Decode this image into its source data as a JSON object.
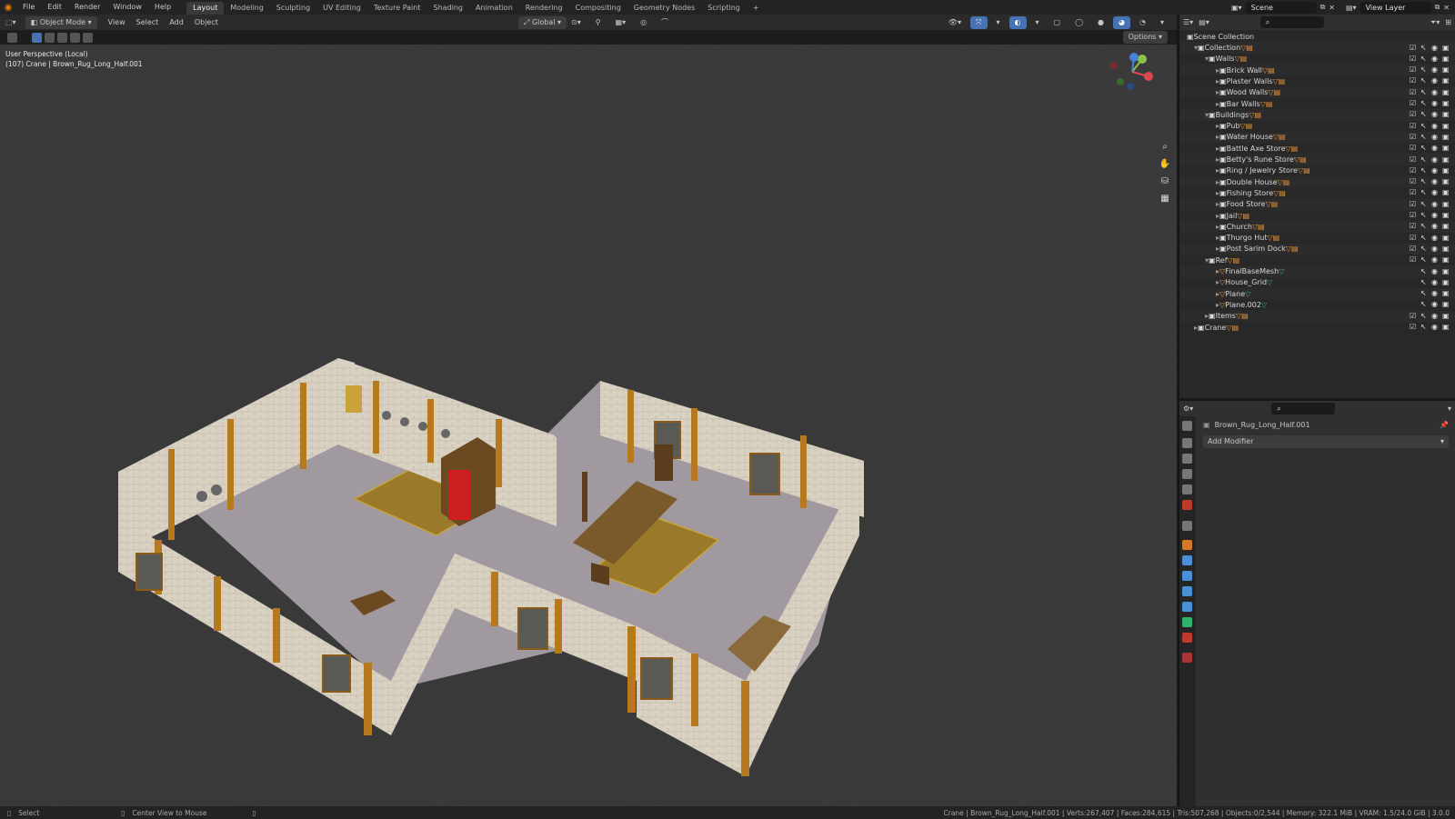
{
  "topbar": {
    "menus": [
      "File",
      "Edit",
      "Render",
      "Window",
      "Help"
    ],
    "workspaces": [
      "Layout",
      "Modeling",
      "Sculpting",
      "UV Editing",
      "Texture Paint",
      "Shading",
      "Animation",
      "Rendering",
      "Compositing",
      "Geometry Nodes",
      "Scripting"
    ],
    "active_workspace": "Layout",
    "scene": "Scene",
    "view_layer": "View Layer"
  },
  "viewport_header": {
    "mode": "Object Mode",
    "menus": [
      "View",
      "Select",
      "Add",
      "Object"
    ],
    "orientation": "Global",
    "options_label": "Options"
  },
  "viewport": {
    "perspective": "User Perspective (Local)",
    "selection": "(107) Crane | Brown_Rug_Long_Half.001"
  },
  "outliner": {
    "root": "Scene Collection",
    "rows": [
      {
        "label": "Collection",
        "depth": 1,
        "kind": "collection",
        "expanded": true
      },
      {
        "label": "Walls",
        "depth": 2,
        "kind": "collection",
        "expanded": true
      },
      {
        "label": "Brick Wall",
        "depth": 3,
        "kind": "object"
      },
      {
        "label": "Plaster Walls",
        "depth": 3,
        "kind": "object"
      },
      {
        "label": "Wood Walls",
        "depth": 3,
        "kind": "object"
      },
      {
        "label": "Bar Walls",
        "depth": 3,
        "kind": "object"
      },
      {
        "label": "Buildings",
        "depth": 2,
        "kind": "collection",
        "expanded": true
      },
      {
        "label": "Pub",
        "depth": 3,
        "kind": "object"
      },
      {
        "label": "Water House",
        "depth": 3,
        "kind": "object"
      },
      {
        "label": "Battle Axe Store",
        "depth": 3,
        "kind": "object"
      },
      {
        "label": "Betty's Rune Store",
        "depth": 3,
        "kind": "object"
      },
      {
        "label": "Ring / Jewelry Store",
        "depth": 3,
        "kind": "object"
      },
      {
        "label": "Double House",
        "depth": 3,
        "kind": "object"
      },
      {
        "label": "Fishing Store",
        "depth": 3,
        "kind": "object"
      },
      {
        "label": "Food Store",
        "depth": 3,
        "kind": "object"
      },
      {
        "label": "Jail",
        "depth": 3,
        "kind": "object"
      },
      {
        "label": "Church",
        "depth": 3,
        "kind": "object"
      },
      {
        "label": "Thurgo Hut",
        "depth": 3,
        "kind": "object"
      },
      {
        "label": "Post Sarim Dock",
        "depth": 3,
        "kind": "object"
      },
      {
        "label": "Ref",
        "depth": 2,
        "kind": "collection",
        "expanded": true
      },
      {
        "label": "FinalBaseMesh",
        "depth": 3,
        "kind": "mesh"
      },
      {
        "label": "House_Grid",
        "depth": 3,
        "kind": "mesh"
      },
      {
        "label": "Plane",
        "depth": 3,
        "kind": "mesh"
      },
      {
        "label": "Plane.002",
        "depth": 3,
        "kind": "mesh"
      },
      {
        "label": "Items",
        "depth": 2,
        "kind": "collection"
      },
      {
        "label": "Crane",
        "depth": 1,
        "kind": "collection"
      }
    ]
  },
  "properties": {
    "object_name": "Brown_Rug_Long_Half.001",
    "add_modifier": "Add Modifier"
  },
  "statusbar": {
    "select": "Select",
    "center": "Center View to Mouse",
    "stats": "Crane | Brown_Rug_Long_Half.001 | Verts:267,407 | Faces:284,615 | Tris:507,268 | Objects:0/2,544 | Memory: 322.1 MiB | VRAM: 1.5/24.0 GiB | 3.0.0"
  },
  "colors": {
    "accent": "#4772b3",
    "wall": "#d9d2c2",
    "beam": "#b7791f",
    "floor": "#a09aa0",
    "rug": "#9a7a2a",
    "wood": "#6b4a22"
  }
}
